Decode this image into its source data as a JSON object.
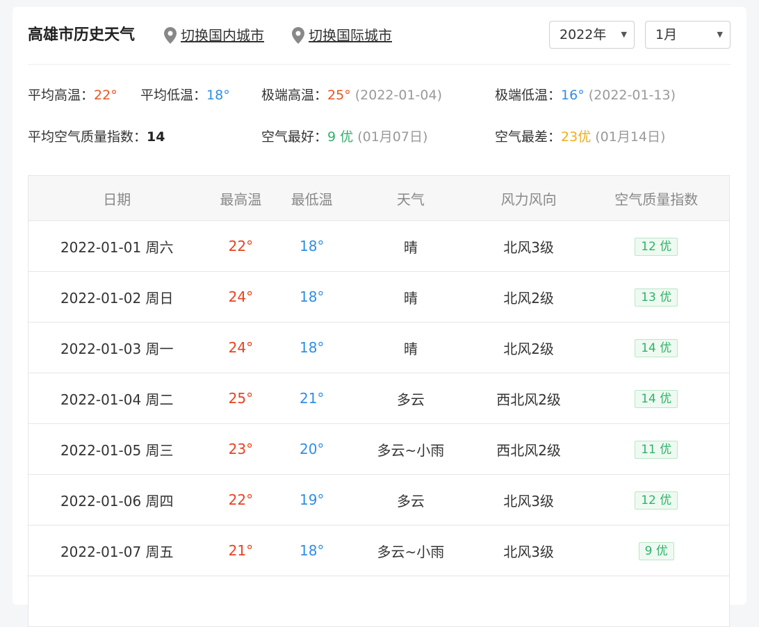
{
  "header": {
    "title": "高雄市历史天气",
    "switch_domestic": "切换国内城市",
    "switch_international": "切换国际城市",
    "year_select": "2022年",
    "month_select": "1月"
  },
  "stats": {
    "avg_high_label": "平均高温：",
    "avg_high_value": "22°",
    "avg_low_label": "平均低温：",
    "avg_low_value": "18°",
    "extreme_high_label": "极端高温：",
    "extreme_high_value": "25°",
    "extreme_high_date": "(2022-01-04)",
    "extreme_low_label": "极端低温：",
    "extreme_low_value": "16°",
    "extreme_low_date": "(2022-01-13)",
    "avg_aqi_label": "平均空气质量指数：",
    "avg_aqi_value": "14",
    "best_air_label": "空气最好：",
    "best_air_value": "9 优",
    "best_air_date": "(01月07日)",
    "worst_air_label": "空气最差：",
    "worst_air_value": "23优",
    "worst_air_date": "(01月14日)"
  },
  "table": {
    "columns": [
      "日期",
      "最高温",
      "最低温",
      "天气",
      "风力风向",
      "空气质量指数"
    ],
    "rows": [
      {
        "date": "2022-01-01 周六",
        "high": "22°",
        "low": "18°",
        "weather": "晴",
        "wind": "北风3级",
        "aqi": "12 优"
      },
      {
        "date": "2022-01-02 周日",
        "high": "24°",
        "low": "18°",
        "weather": "晴",
        "wind": "北风2级",
        "aqi": "13 优"
      },
      {
        "date": "2022-01-03 周一",
        "high": "24°",
        "low": "18°",
        "weather": "晴",
        "wind": "北风2级",
        "aqi": "14 优"
      },
      {
        "date": "2022-01-04 周二",
        "high": "25°",
        "low": "21°",
        "weather": "多云",
        "wind": "西北风2级",
        "aqi": "14 优"
      },
      {
        "date": "2022-01-05 周三",
        "high": "23°",
        "low": "20°",
        "weather": "多云~小雨",
        "wind": "西北风2级",
        "aqi": "11 优"
      },
      {
        "date": "2022-01-06 周四",
        "high": "22°",
        "low": "19°",
        "weather": "多云",
        "wind": "北风3级",
        "aqi": "12 优"
      },
      {
        "date": "2022-01-07 周五",
        "high": "21°",
        "low": "18°",
        "weather": "多云~小雨",
        "wind": "北风3级",
        "aqi": "9 优"
      }
    ]
  },
  "colors": {
    "high_temp": "#e9401e",
    "low_temp": "#2e8ee6",
    "aqi_good": "#2fb26a",
    "aqi_warn": "#f0ac1c"
  },
  "icons": {
    "location": "location-pin-icon",
    "dropdown": "caret-down-icon"
  }
}
